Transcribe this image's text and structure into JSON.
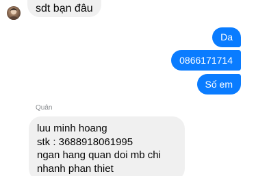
{
  "messages": {
    "first_incoming": "sdt bạn đâu",
    "outgoing": [
      "Da",
      "0866171714",
      "Số em"
    ],
    "sender_name": "Quân",
    "second_incoming_lines": [
      "luu minh hoang",
      "stk : 3688918061995",
      "ngan hang quan doi mb chi",
      "nhanh phan thiet"
    ]
  },
  "colors": {
    "outgoing_bubble": "#0a7cff",
    "incoming_bubble": "#f0f0f0",
    "background": "#ffffff",
    "sender_label": "#8a8d91"
  },
  "icons": {
    "avatar": "avatar"
  }
}
